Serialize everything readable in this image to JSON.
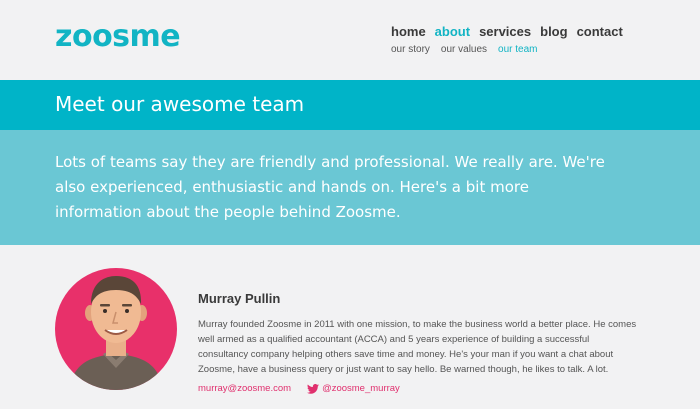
{
  "brand": {
    "logo": "zoosme",
    "accent": "#12b4c4",
    "link_color": "#e0306e"
  },
  "nav": {
    "main": [
      {
        "label": "home",
        "active": false
      },
      {
        "label": "about",
        "active": true
      },
      {
        "label": "services",
        "active": false
      },
      {
        "label": "blog",
        "active": false
      },
      {
        "label": "contact",
        "active": false
      }
    ],
    "sub": [
      {
        "label": "our story",
        "active": false
      },
      {
        "label": "our values",
        "active": false
      },
      {
        "label": "our team",
        "active": true
      }
    ]
  },
  "banner": {
    "title": "Meet our awesome team"
  },
  "intro": {
    "text": "Lots of teams say they are friendly and professional. We really are. We're also experienced, enthusiastic and hands on. Here's a bit more information about the people behind Zoosme."
  },
  "member": {
    "name": "Murray Pullin",
    "bio": "Murray founded Zoosme in 2011 with one mission, to make the business world a better place. He comes well armed as a qualified accountant (ACCA) and 5 years experience of building a successful consultancy company helping others save time and money. He's your man if you want a chat about Zoosme, have a business query or just want to say hello. Be warned though, he likes to talk. A lot.",
    "email": "murray@zoosme.com",
    "twitter": "@zoosme_murray",
    "avatar_icon": "person-avatar-illustration"
  }
}
